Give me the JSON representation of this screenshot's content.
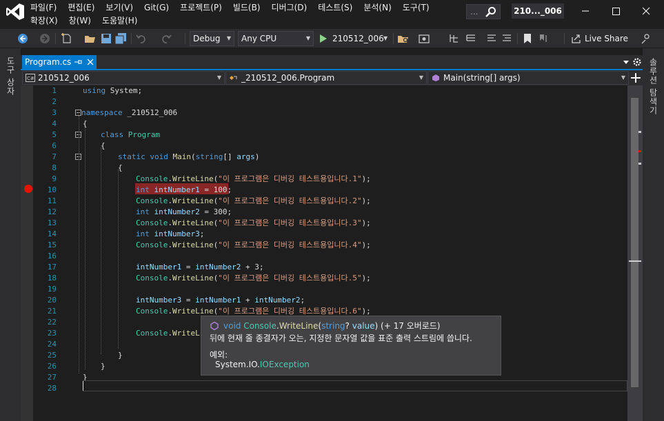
{
  "menu": {
    "row1": [
      "파일(F)",
      "편집(E)",
      "보기(V)",
      "Git(G)",
      "프로젝트(P)",
      "빌드(B)",
      "디버그(D)",
      "테스트(S)",
      "분석(N)",
      "도구(T)"
    ],
    "row2": [
      "확장(X)",
      "창(W)",
      "도움말(H)"
    ]
  },
  "search": {
    "text": "..."
  },
  "solution_name": "210..._006",
  "toolbar": {
    "config": "Debug",
    "platform": "Any CPU",
    "start_target": "210512_006",
    "live_share": "Live Share"
  },
  "side_tabs": {
    "left": "도구 상자",
    "right": "솔루션 탐색기"
  },
  "doc_tab": {
    "label": "Program.cs"
  },
  "nav": {
    "project": "210512_006",
    "type": "_210512_006.Program",
    "member": "Main(string[] args)"
  },
  "code": {
    "line_numbers": [
      "1",
      "2",
      "3",
      "4",
      "5",
      "6",
      "7",
      "8",
      "9",
      "10",
      "11",
      "12",
      "13",
      "14",
      "15",
      "16",
      "17",
      "18",
      "19",
      "20",
      "21",
      "22",
      "23",
      "24",
      "25",
      "26",
      "27",
      "28"
    ],
    "l1": [
      "using",
      " ",
      "System",
      ";"
    ],
    "l3": [
      "namespace",
      " ",
      "_210512_006"
    ],
    "l4": "{",
    "l5": [
      "class",
      " ",
      "Program"
    ],
    "l6": "{",
    "l7": [
      "static",
      " ",
      "void",
      " ",
      "Main",
      "(",
      "string",
      "[] ",
      "args",
      ")"
    ],
    "l8": "{",
    "l9": [
      "Console",
      ".",
      "WriteLine",
      "(",
      "\"이 프로그램은 디버깅 테스트용입니다.1\"",
      ");"
    ],
    "l10": [
      "int",
      " ",
      "intNumber1",
      " = ",
      "100",
      ";"
    ],
    "l11": [
      "Console",
      ".",
      "WriteLine",
      "(",
      "\"이 프로그램은 디버깅 테스트용입니다.2\"",
      ");"
    ],
    "l12": [
      "int",
      " ",
      "intNumber2",
      " = ",
      "300",
      ";"
    ],
    "l13": [
      "Console",
      ".",
      "WriteLine",
      "(",
      "\"이 프로그램은 디버깅 테스트용입니다.3\"",
      ");"
    ],
    "l14": [
      "int",
      " ",
      "intNumber3",
      ";"
    ],
    "l15": [
      "Console",
      ".",
      "WriteLine",
      "(",
      "\"이 프로그램은 디버깅 테스트용입니다.4\"",
      ");"
    ],
    "l17": [
      "intNumber1",
      " = ",
      "intNumber2",
      " + ",
      "3",
      ";"
    ],
    "l18": [
      "Console",
      ".",
      "WriteLine",
      "(",
      "\"이 프로그램은 디버깅 테스트용입니다.5\"",
      ");"
    ],
    "l20": [
      "intNumber3",
      " = ",
      "intNumber1",
      " + ",
      "intNumber2",
      ";"
    ],
    "l21": [
      "Console",
      ".",
      "WriteLine",
      "(",
      "\"이 프로그램은 디버깅 테스트용입니다.6\"",
      ");"
    ],
    "l23": [
      "Console",
      ".",
      "WriteL"
    ],
    "l25": "}",
    "l26": "}",
    "l27": "}"
  },
  "tooltip": {
    "sig": [
      "void",
      " ",
      "Console",
      ".",
      "WriteLine",
      "(",
      "string",
      "? ",
      "value",
      ") (+ 17 오버로드)"
    ],
    "description": "뒤에 현재 줄 종결자가 오는, 지정한 문자열 값을 표준 출력 스트림에 씁니다.",
    "exceptions_label": "예외:",
    "exception_ns": "System.IO.",
    "exception_type": "IOException"
  },
  "colors": {
    "accent": "#007acc",
    "breakpoint": "#e51400",
    "keyword": "#569cd6",
    "type": "#4ec9b0",
    "method": "#dcdcaa",
    "string": "#d69d85"
  }
}
